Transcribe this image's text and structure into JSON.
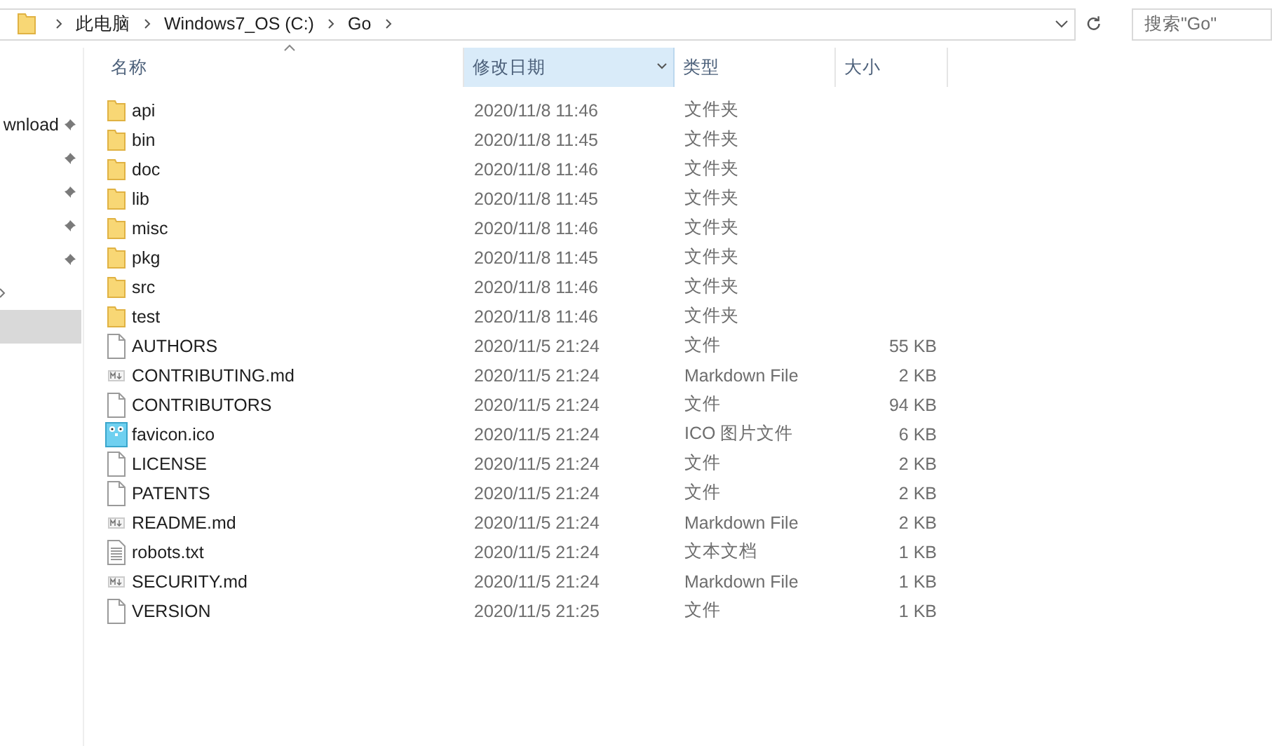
{
  "address_bar": {
    "segments": [
      "此电脑",
      "Windows7_OS (C:)",
      "Go"
    ]
  },
  "search": {
    "placeholder": "搜索\"Go\""
  },
  "sidebar": {
    "items": [
      {
        "label": "wnload",
        "pinned": true,
        "selected": false
      },
      {
        "pinned": true,
        "selected": false
      },
      {
        "pinned": true,
        "selected": false
      },
      {
        "pinned": true,
        "selected": false
      },
      {
        "pinned": true,
        "selected": false
      },
      {
        "pinned": false,
        "selected": false,
        "expandable": true
      },
      {
        "pinned": false,
        "selected": true
      }
    ]
  },
  "table": {
    "columns": [
      {
        "label": "名称",
        "sorted": true,
        "highlighted": false
      },
      {
        "label": "修改日期",
        "sorted": false,
        "highlighted": true
      },
      {
        "label": "类型",
        "sorted": false,
        "highlighted": false
      },
      {
        "label": "大小",
        "sorted": false,
        "highlighted": false
      }
    ],
    "rows": [
      {
        "kind": "folder",
        "name": "api",
        "date": "2020/11/8 11:46",
        "type": "文件夹"
      },
      {
        "kind": "folder",
        "name": "bin",
        "date": "2020/11/8 11:45",
        "type": "文件夹"
      },
      {
        "kind": "folder",
        "name": "doc",
        "date": "2020/11/8 11:46",
        "type": "文件夹"
      },
      {
        "kind": "folder",
        "name": "lib",
        "date": "2020/11/8 11:45",
        "type": "文件夹"
      },
      {
        "kind": "folder",
        "name": "misc",
        "date": "2020/11/8 11:46",
        "type": "文件夹"
      },
      {
        "kind": "folder",
        "name": "pkg",
        "date": "2020/11/8 11:45",
        "type": "文件夹"
      },
      {
        "kind": "folder",
        "name": "src",
        "date": "2020/11/8 11:46",
        "type": "文件夹"
      },
      {
        "kind": "folder",
        "name": "test",
        "date": "2020/11/8 11:46",
        "type": "文件夹"
      },
      {
        "kind": "file",
        "name": "AUTHORS",
        "date": "2020/11/5 21:24",
        "type": "文件",
        "size": "55 KB"
      },
      {
        "kind": "markdown",
        "name": "CONTRIBUTING.md",
        "date": "2020/11/5 21:24",
        "type": "Markdown File",
        "size": "2 KB"
      },
      {
        "kind": "file",
        "name": "CONTRIBUTORS",
        "date": "2020/11/5 21:24",
        "type": "文件",
        "size": "94 KB"
      },
      {
        "kind": "image",
        "name": "favicon.ico",
        "date": "2020/11/5 21:24",
        "type": "ICO 图片文件",
        "size": "6 KB"
      },
      {
        "kind": "file",
        "name": "LICENSE",
        "date": "2020/11/5 21:24",
        "type": "文件",
        "size": "2 KB"
      },
      {
        "kind": "file",
        "name": "PATENTS",
        "date": "2020/11/5 21:24",
        "type": "文件",
        "size": "2 KB"
      },
      {
        "kind": "markdown",
        "name": "README.md",
        "date": "2020/11/5 21:24",
        "type": "Markdown File",
        "size": "2 KB"
      },
      {
        "kind": "text",
        "name": "robots.txt",
        "date": "2020/11/5 21:24",
        "type": "文本文档",
        "size": "1 KB"
      },
      {
        "kind": "markdown",
        "name": "SECURITY.md",
        "date": "2020/11/5 21:24",
        "type": "Markdown File",
        "size": "1 KB"
      },
      {
        "kind": "file",
        "name": "VERSION",
        "date": "2020/11/5 21:25",
        "type": "文件",
        "size": "1 KB"
      }
    ]
  }
}
